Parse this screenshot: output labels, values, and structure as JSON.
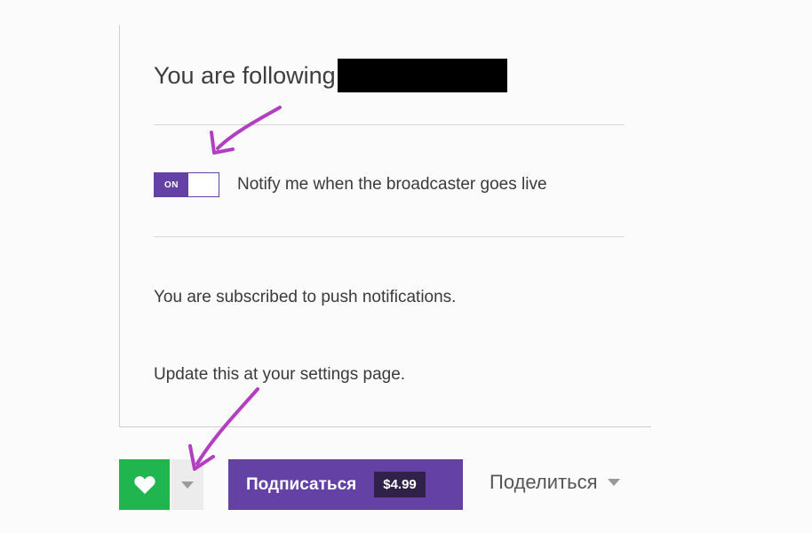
{
  "panel": {
    "title": "You are following",
    "notify_toggle_state": "ON",
    "notify_label": "Notify me when the broadcaster goes live",
    "push_status": "You are subscribed to push notifications.",
    "settings_hint": "Update this at your settings page."
  },
  "actions": {
    "follow_icon": "heart-icon",
    "subscribe_label": "Подписаться",
    "subscribe_price": "$4.99",
    "share_label": "Поделиться"
  },
  "colors": {
    "brand_purple": "#6441a5",
    "follow_green": "#20b54e",
    "annotation_arrow": "#b23fc0"
  }
}
